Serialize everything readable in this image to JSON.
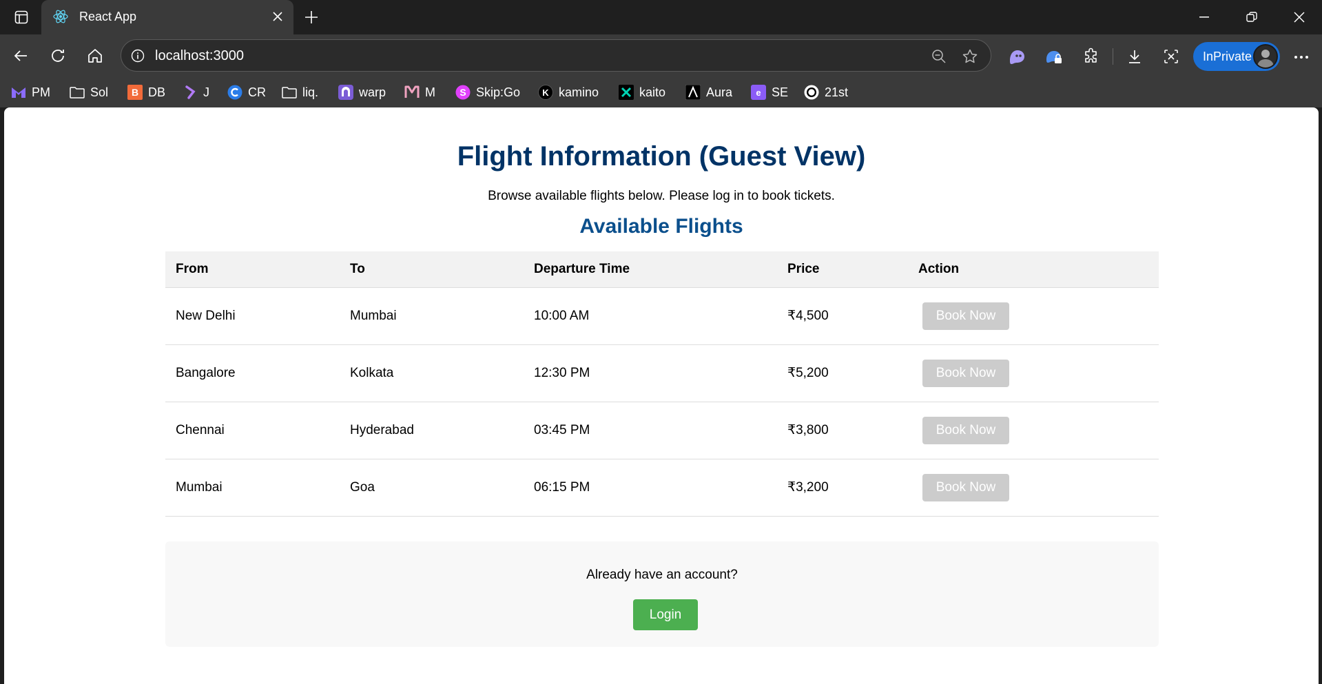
{
  "browser": {
    "tab": {
      "title": "React App"
    },
    "address": {
      "url": "localhost:3000"
    },
    "inprivate_label": "InPrivate",
    "bookmarks": [
      {
        "label": "PM",
        "icon": "proton-mail-icon",
        "color": "#6d4aff"
      },
      {
        "label": "Sol",
        "icon": "folder-icon",
        "color": "#ffffff"
      },
      {
        "label": "DB",
        "icon": "db-icon",
        "color": "#f26b3a"
      },
      {
        "label": "J",
        "icon": "j-icon",
        "color": "#9b5de5"
      },
      {
        "label": "CR",
        "icon": "cr-icon",
        "color": "#2b7de9"
      },
      {
        "label": "liq.",
        "icon": "folder-icon",
        "color": "#ffffff"
      },
      {
        "label": "warp",
        "icon": "warp-icon",
        "color": "#7b5cd6"
      },
      {
        "label": "M",
        "icon": "m-icon",
        "color": "#f0a3c0"
      },
      {
        "label": "Skip:Go",
        "icon": "skipgo-icon",
        "color": "#e040fb"
      },
      {
        "label": "kamino",
        "icon": "kamino-icon",
        "color": "#000000"
      },
      {
        "label": "kaito",
        "icon": "kaito-icon",
        "color": "#00d4b4"
      },
      {
        "label": "Aura",
        "icon": "aura-icon",
        "color": "#000000"
      },
      {
        "label": "SE",
        "icon": "se-icon",
        "color": "#8b5cf6"
      },
      {
        "label": "21st",
        "icon": "21st-icon",
        "color": "#ffffff"
      }
    ]
  },
  "page": {
    "title": "Flight Information (Guest View)",
    "subtitle": "Browse available flights below. Please log in to book tickets.",
    "section_title": "Available Flights",
    "table": {
      "headers": [
        "From",
        "To",
        "Departure Time",
        "Price",
        "Action"
      ],
      "rows": [
        {
          "from": "New Delhi",
          "to": "Mumbai",
          "time": "10:00 AM",
          "price": "₹4,500",
          "action": "Book Now"
        },
        {
          "from": "Bangalore",
          "to": "Kolkata",
          "time": "12:30 PM",
          "price": "₹5,200",
          "action": "Book Now"
        },
        {
          "from": "Chennai",
          "to": "Hyderabad",
          "time": "03:45 PM",
          "price": "₹3,800",
          "action": "Book Now"
        },
        {
          "from": "Mumbai",
          "to": "Goa",
          "time": "06:15 PM",
          "price": "₹3,200",
          "action": "Book Now"
        }
      ]
    },
    "login": {
      "prompt": "Already have an account?",
      "button": "Login"
    }
  },
  "colors": {
    "title": "#003366",
    "section_title": "#0b4f8c",
    "book_button_disabled": "#cccccc",
    "login_button": "#4caf50",
    "inprivate": "#1a6fd6"
  }
}
